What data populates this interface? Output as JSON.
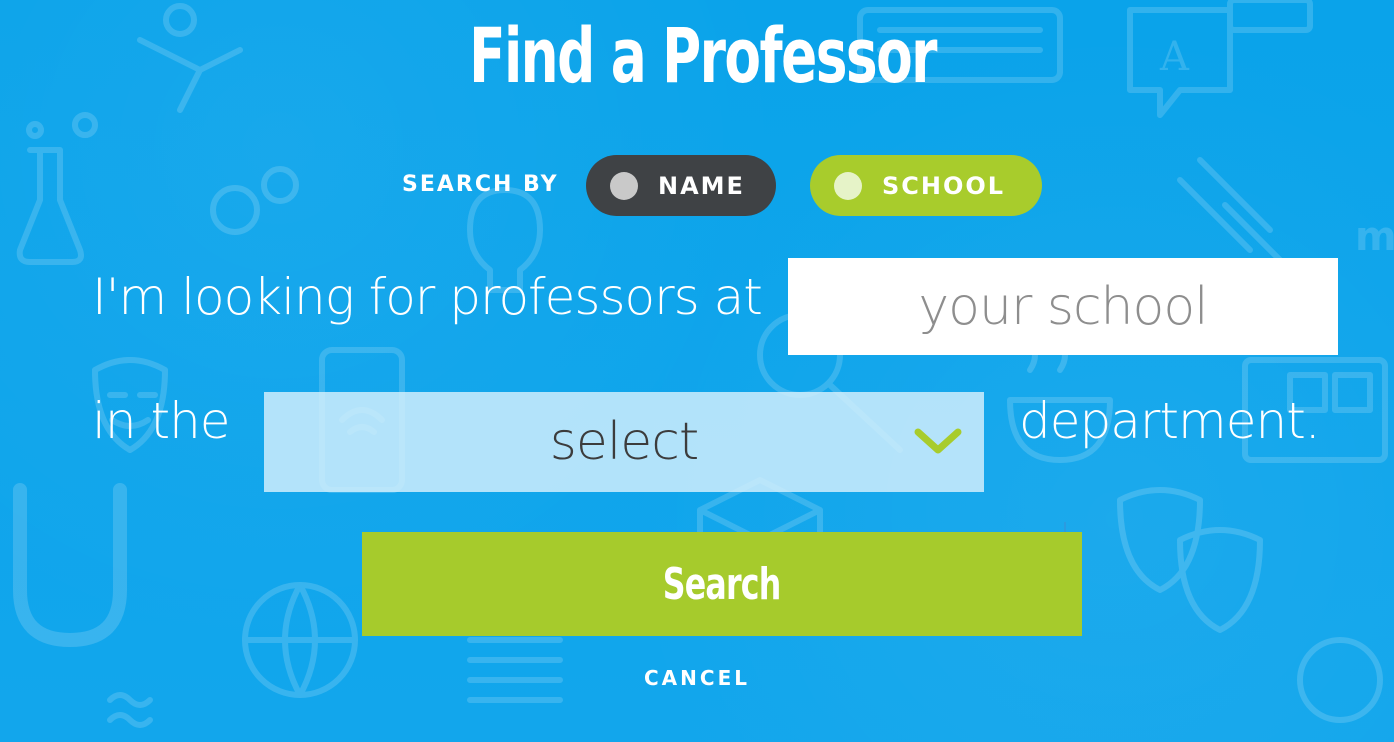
{
  "page": {
    "title": "Find a Professor"
  },
  "search_by": {
    "label": "SEARCH BY",
    "options": [
      {
        "label": "NAME",
        "selected": false
      },
      {
        "label": "SCHOOL",
        "selected": true
      }
    ]
  },
  "form": {
    "sentence_part1": "I'm looking for professors at",
    "school_input_placeholder": "your school",
    "sentence_part2": "in the",
    "department_select_value": "select",
    "sentence_part3": "department."
  },
  "actions": {
    "search_label": "Search",
    "cancel_label": "CANCEL"
  },
  "colors": {
    "background": "#0ea5ea",
    "accent_green": "#a8cc2c",
    "pill_dark": "#3f4245"
  },
  "icons": {
    "select_chevron": "chevron-down-icon",
    "background_pattern": "education-doodle-pattern"
  }
}
